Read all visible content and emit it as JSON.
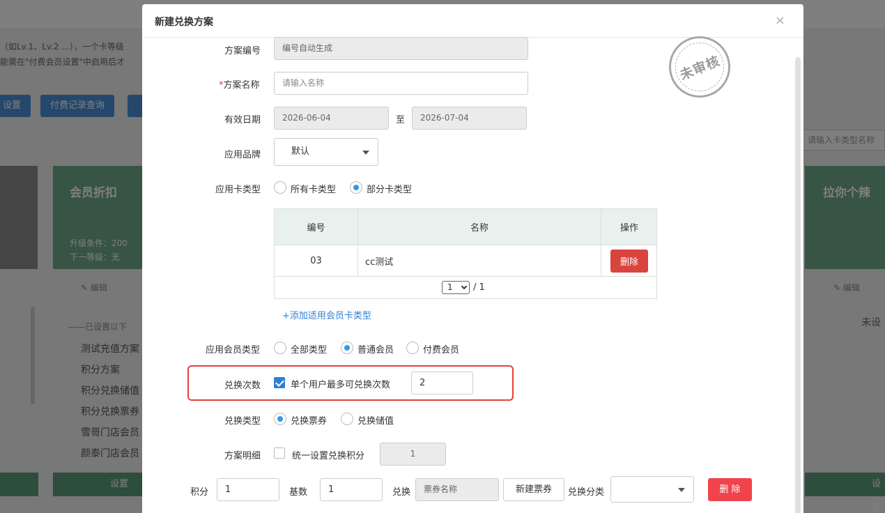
{
  "background": {
    "note_line1": "（如Lv.1、Lv.2 ...），一个卡等级",
    "note_line2": "能需在\"付费会员设置\"中启用后才",
    "btn_settings": "设置",
    "btn_records": "付费记录查询",
    "search_placeholder": "请输入卡类型名称",
    "card_title": "会员折扣",
    "card_upgrade": "升级条件：200",
    "card_next": "下一等级：无",
    "card_right_title": "拉你个辣",
    "edit_label": "编辑",
    "list_title": "——已设置以下",
    "list_items": [
      "测试充值方案",
      "积分方案",
      "积分兑换储值",
      "积分兑换票券",
      "雪哥门店会员",
      "颜泰门店会员"
    ],
    "unset_label": "未设",
    "green_btn_label": "设置"
  },
  "modal": {
    "title": "新建兑换方案",
    "close_glyph": "×",
    "stamp_text": "未审核",
    "fields": {
      "scheme_no_label": "方案编号",
      "scheme_no_value": "编号自动生成",
      "scheme_name_required": "*",
      "scheme_name_label": "方案名称",
      "scheme_name_placeholder": "请输入名称",
      "valid_date_label": "有效日期",
      "date_start": "2026-06-04",
      "date_to": "至",
      "date_end": "2026-07-04",
      "brand_label": "应用品牌",
      "brand_value": "默认",
      "card_type_label": "应用卡类型",
      "card_type_all": "所有卡类型",
      "card_type_part": "部分卡类型",
      "member_type_label": "应用会员类型",
      "member_type_all": "全部类型",
      "member_type_normal": "普通会员",
      "member_type_paid": "付费会员",
      "exchange_count_label": "兑换次数",
      "exchange_count_check": "单个用户最多可兑换次数",
      "exchange_count_value": "2",
      "exchange_type_label": "兑换类型",
      "exchange_type_ticket": "兑换票券",
      "exchange_type_value": "兑换储值",
      "detail_label": "方案明细",
      "detail_check": "统一设置兑换积分",
      "detail_value": "1"
    },
    "table": {
      "headers": [
        "编号",
        "名称",
        "操作"
      ],
      "rows": [
        {
          "code": "03",
          "name": "cc测试",
          "action": "删除"
        }
      ],
      "page_current": "1",
      "page_total": "/ 1"
    },
    "add_card_type_link": "+添加适用会员卡类型",
    "bottom_row": {
      "points_label": "积分",
      "points_value": "1",
      "base_label": "基数",
      "base_value": "1",
      "exchange_label": "兑换",
      "ticket_placeholder": "票券名称",
      "new_ticket_btn": "新建票券",
      "category_label": "兑换分类",
      "delete_btn": "删 除"
    }
  }
}
